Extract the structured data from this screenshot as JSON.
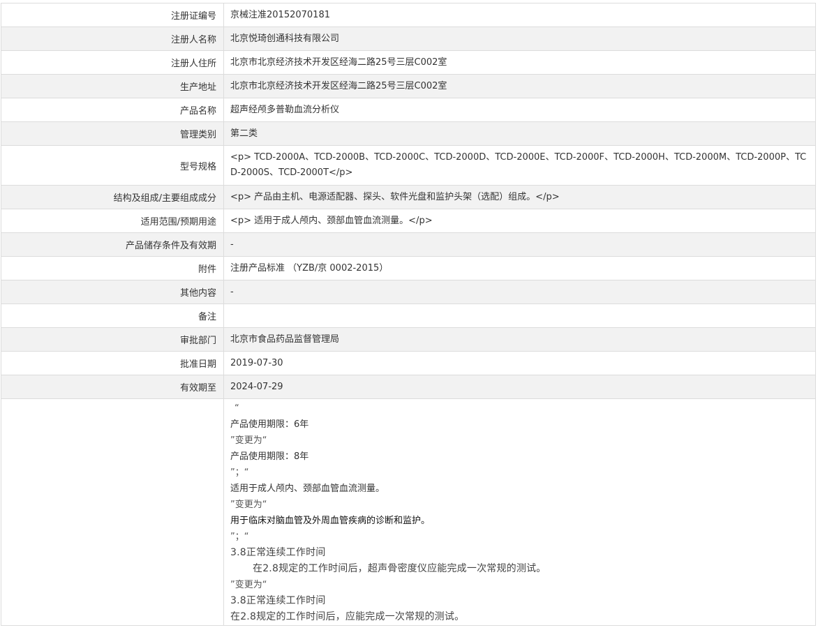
{
  "rows": [
    {
      "label": "注册证编号",
      "value": "京械注准20152070181"
    },
    {
      "label": "注册人名称",
      "value": "北京悦琦创通科技有限公司"
    },
    {
      "label": "注册人住所",
      "value": "北京市北京经济技术开发区经海二路25号三层C002室"
    },
    {
      "label": "生产地址",
      "value": "北京市北京经济技术开发区经海二路25号三层C002室"
    },
    {
      "label": "产品名称",
      "value": "超声经颅多普勒血流分析仪"
    },
    {
      "label": "管理类别",
      "value": "第二类"
    },
    {
      "label": "型号规格",
      "value": "<p> TCD-2000A、TCD-2000B、TCD-2000C、TCD-2000D、TCD-2000E、TCD-2000F、TCD-2000H、TCD-2000M、TCD-2000P、TCD-2000S、TCD-2000T</p>"
    },
    {
      "label": "结构及组成/主要组成成分",
      "value": "<p> 产品由主机、电源适配器、探头、软件光盘和监护头架（选配）组成。</p>"
    },
    {
      "label": "适用范围/预期用途",
      "value": "<p> 适用于成人颅内、颈部血管血流测量。</p>"
    },
    {
      "label": "产品储存条件及有效期",
      "value": "-"
    },
    {
      "label": "附件",
      "value": "注册产品标准 （YZB/京 0002-2015）"
    },
    {
      "label": "其他内容",
      "value": "-"
    },
    {
      "label": "备注",
      "value": ""
    },
    {
      "label": "审批部门",
      "value": "北京市食品药品监督管理局"
    },
    {
      "label": "批准日期",
      "value": "2019-07-30"
    },
    {
      "label": "有效期至",
      "value": "2024-07-29"
    }
  ],
  "change_notes": {
    "line_01": "“",
    "line_02": "产品使用期限：6年",
    "line_03": "”变更为“",
    "line_04": "产品使用期限：8年",
    "line_05": "”；“",
    "line_06": "适用于成人颅内、颈部血管血流测量。",
    "line_07": "”变更为“",
    "line_08": "用于临床对脑血管及外周血管疾病的诊断和监护。",
    "line_09": "”；“",
    "line_10": "3.8正常连续工作时间",
    "line_11": "在2.8规定的工作时间后，超声骨密度仪应能完成一次常规的测试。",
    "line_12": "”变更为“",
    "line_13": "3.8正常连续工作时间",
    "line_14": "在2.8规定的工作时间后，应能完成一次常规的测试。"
  }
}
